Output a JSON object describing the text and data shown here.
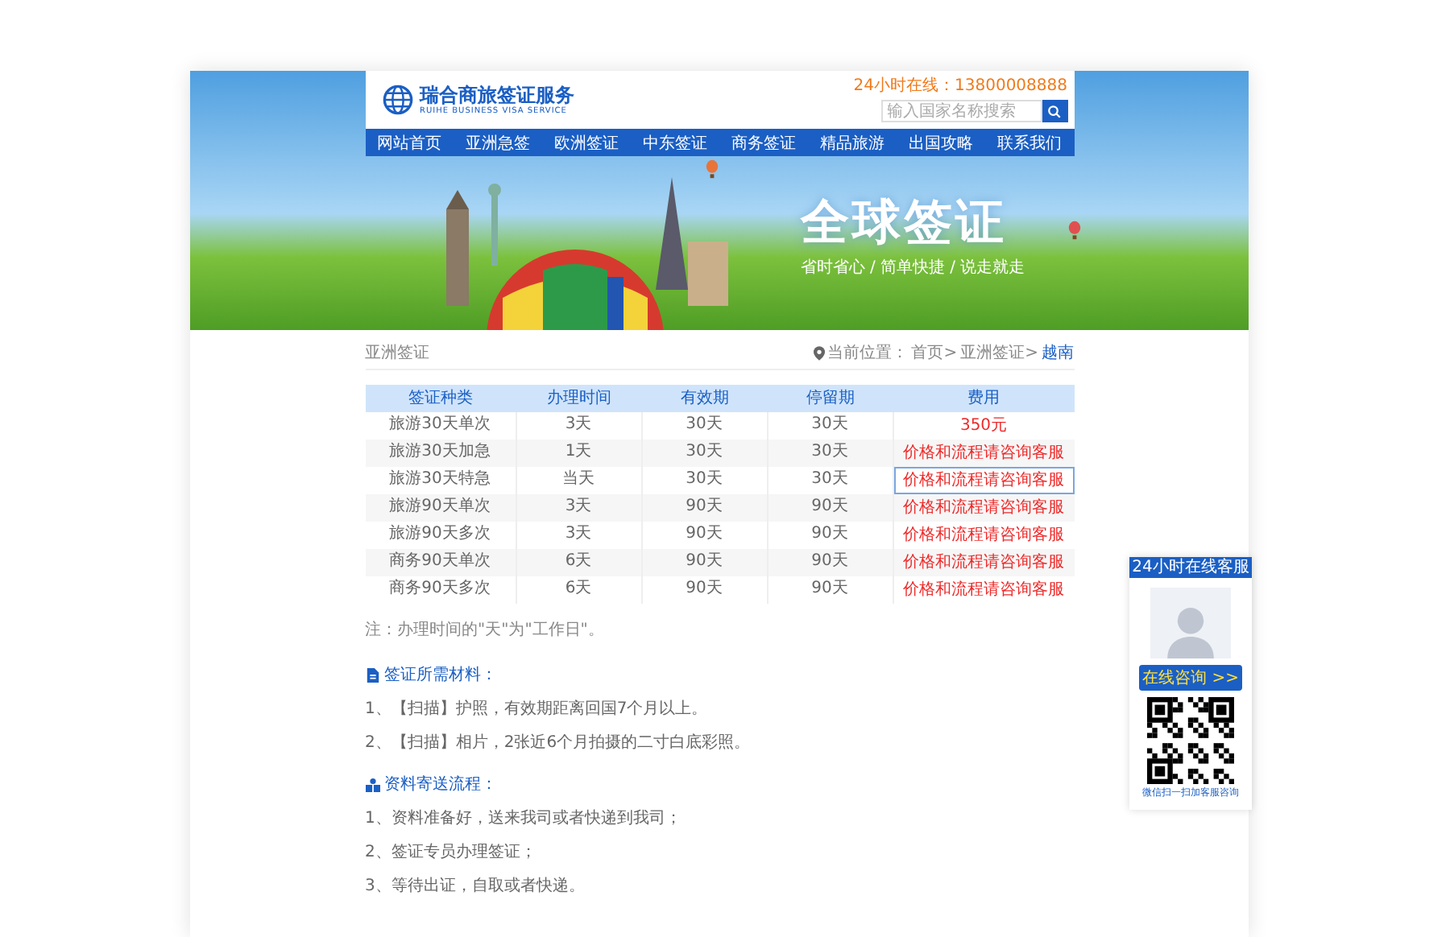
{
  "header": {
    "logo_title": "瑞合商旅签证服务",
    "logo_subtitle": "RUIHE BUSINESS VISA SERVICE",
    "hotline": "24小时在线：13800008888",
    "search": {
      "placeholder": "输入国家名称搜索"
    }
  },
  "nav": [
    "网站首页",
    "亚洲急签",
    "欧洲签证",
    "中东签证",
    "商务签证",
    "精品旅游",
    "出国攻略",
    "联系我们"
  ],
  "banner": {
    "title": "全球签证",
    "tagline": "省时省心 / 简单快捷 / 说走就走"
  },
  "breadcrumb": {
    "section": "亚洲签证",
    "label": "当前位置：",
    "items": [
      {
        "text": "首页>",
        "current": false
      },
      {
        "text": "亚洲签证>",
        "current": false
      },
      {
        "text": "越南",
        "current": true
      }
    ]
  },
  "table": {
    "columns": [
      "签证种类",
      "办理时间",
      "有效期",
      "停留期",
      "费用"
    ],
    "rows": [
      {
        "cells": [
          "旅游30天单次",
          "3天",
          "30天",
          "30天",
          "350元"
        ],
        "selected": false
      },
      {
        "cells": [
          "旅游30天加急",
          "1天",
          "30天",
          "30天",
          "价格和流程请咨询客服"
        ],
        "selected": false
      },
      {
        "cells": [
          "旅游30天特急",
          "当天",
          "30天",
          "30天",
          "价格和流程请咨询客服"
        ],
        "selected": true
      },
      {
        "cells": [
          "旅游90天单次",
          "3天",
          "90天",
          "90天",
          "价格和流程请咨询客服"
        ],
        "selected": false
      },
      {
        "cells": [
          "旅游90天多次",
          "3天",
          "90天",
          "90天",
          "价格和流程请咨询客服"
        ],
        "selected": false
      },
      {
        "cells": [
          "商务90天单次",
          "6天",
          "90天",
          "90天",
          "价格和流程请咨询客服"
        ],
        "selected": false
      },
      {
        "cells": [
          "商务90天多次",
          "6天",
          "90天",
          "90天",
          "价格和流程请咨询客服"
        ],
        "selected": false
      }
    ]
  },
  "note": "注：办理时间的\"天\"为\"工作日\"。",
  "sections": [
    {
      "kind": "document",
      "title": "签证所需材料：",
      "items": [
        "1、【扫描】护照，有效期距离回国7个月以上。",
        "2、【扫描】相片，2张近6个月拍摄的二寸白底彩照。"
      ]
    },
    {
      "kind": "people",
      "title": "资料寄送流程：",
      "items": [
        "1、资料准备好，送来我司或者快递到我司；",
        "2、签证专员办理签证；",
        "3、等待出证，自取或者快递。"
      ]
    }
  ],
  "support": {
    "title": "24小时在线客服",
    "button": "在线咨询 >>",
    "qr_caption": "微信扫一扫加客服咨询"
  }
}
